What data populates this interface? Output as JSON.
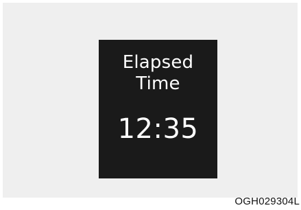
{
  "display": {
    "label_line1": "Elapsed",
    "label_line2": "Time",
    "value": "12:35"
  },
  "figure_code": "OGH029304L",
  "colors": {
    "background": "#efefef",
    "screen": "#1a1a1a",
    "text": "#ffffff"
  }
}
